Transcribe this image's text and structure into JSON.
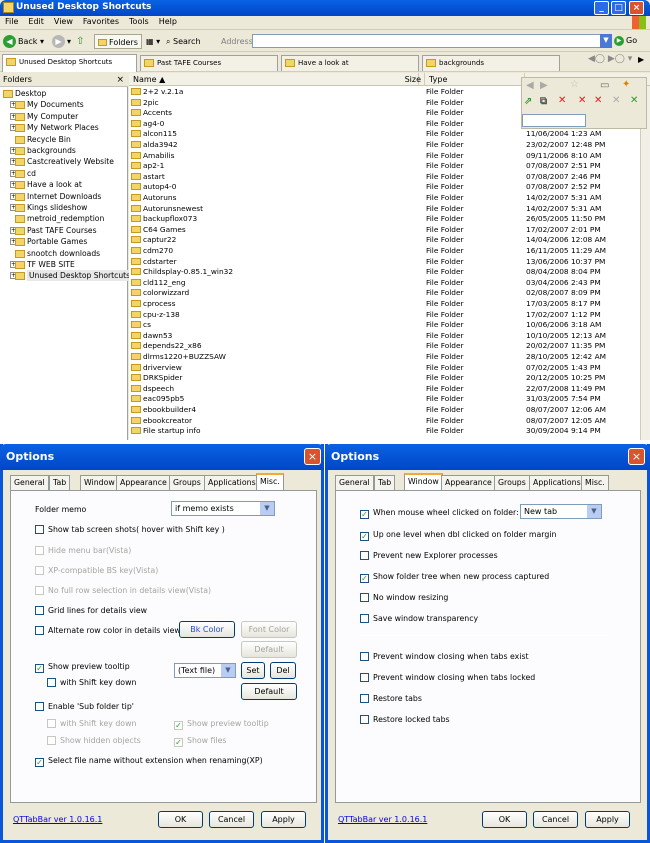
{
  "explorer": {
    "title": "Unused Desktop Shortcuts",
    "menu": [
      "File",
      "Edit",
      "View",
      "Favorites",
      "Tools",
      "Help"
    ],
    "toolbar": {
      "back": "Back",
      "folders": "Folders",
      "search": "Search",
      "address_label": "Address",
      "address_value": "",
      "go": "Go"
    },
    "tabs": [
      "Unused Desktop Shortcuts",
      "Past TAFE Courses",
      "Have a look at",
      "backgrounds"
    ],
    "folders_header": "Folders",
    "tree": [
      {
        "label": "Desktop",
        "level": 0,
        "expander": "-"
      },
      {
        "label": "My Documents",
        "level": 1,
        "expander": "+"
      },
      {
        "label": "My Computer",
        "level": 1,
        "expander": "+"
      },
      {
        "label": "My Network Places",
        "level": 1,
        "expander": "+"
      },
      {
        "label": "Recycle Bin",
        "level": 1,
        "expander": ""
      },
      {
        "label": "backgrounds",
        "level": 1,
        "expander": "+"
      },
      {
        "label": "Castcreatively Website",
        "level": 1,
        "expander": "+"
      },
      {
        "label": "cd",
        "level": 1,
        "expander": "+"
      },
      {
        "label": "Have a look at",
        "level": 1,
        "expander": "+"
      },
      {
        "label": "Internet Downloads",
        "level": 1,
        "expander": "+"
      },
      {
        "label": "Kings slideshow",
        "level": 1,
        "expander": "+"
      },
      {
        "label": "metroid_redemption",
        "level": 1,
        "expander": ""
      },
      {
        "label": "Past TAFE Courses",
        "level": 1,
        "expander": "+"
      },
      {
        "label": "Portable Games",
        "level": 1,
        "expander": "+"
      },
      {
        "label": "snootch downloads",
        "level": 1,
        "expander": ""
      },
      {
        "label": "TF WEB SITE",
        "level": 1,
        "expander": "+"
      },
      {
        "label": "Unused Desktop Shortcuts",
        "level": 1,
        "expander": "+"
      }
    ],
    "columns": {
      "name": "Name",
      "size": "Size",
      "type": "Type"
    },
    "files": [
      {
        "name": "2+2 v.2.1a",
        "type": "File Folder",
        "date": ""
      },
      {
        "name": "2pic",
        "type": "File Folder",
        "date": ""
      },
      {
        "name": "Accents",
        "type": "File Folder",
        "date": ""
      },
      {
        "name": "ag4-0",
        "type": "File Folder",
        "date": ""
      },
      {
        "name": "alcon115",
        "type": "File Folder",
        "date": "11/06/2004 1:23 AM"
      },
      {
        "name": "alda3942",
        "type": "File Folder",
        "date": "23/02/2007 12:48 PM"
      },
      {
        "name": "Amabilis",
        "type": "File Folder",
        "date": "09/11/2006 8:10 AM"
      },
      {
        "name": "ap2-1",
        "type": "File Folder",
        "date": "07/08/2007 2:51 PM"
      },
      {
        "name": "astart",
        "type": "File Folder",
        "date": "07/08/2007 2:46 PM"
      },
      {
        "name": "autop4-0",
        "type": "File Folder",
        "date": "07/08/2007 2:52 PM"
      },
      {
        "name": "Autoruns",
        "type": "File Folder",
        "date": "14/02/2007 5:31 AM"
      },
      {
        "name": "Autorunsnewest",
        "type": "File Folder",
        "date": "14/02/2007 5:31 AM"
      },
      {
        "name": "backupflox073",
        "type": "File Folder",
        "date": "26/05/2005 11:50 PM"
      },
      {
        "name": "C64 Games",
        "type": "File Folder",
        "date": "17/02/2007 2:01 PM"
      },
      {
        "name": "captur22",
        "type": "File Folder",
        "date": "14/04/2006 12:08 AM"
      },
      {
        "name": "cdm270",
        "type": "File Folder",
        "date": "16/11/2005 11:29 AM"
      },
      {
        "name": "cdstarter",
        "type": "File Folder",
        "date": "13/06/2006 10:37 PM"
      },
      {
        "name": "Childsplay-0.85.1_win32",
        "type": "File Folder",
        "date": "08/04/2008 8:04 PM"
      },
      {
        "name": "cld112_eng",
        "type": "File Folder",
        "date": "03/04/2006 2:43 PM"
      },
      {
        "name": "colorwizzard",
        "type": "File Folder",
        "date": "02/08/2007 8:09 PM"
      },
      {
        "name": "cprocess",
        "type": "File Folder",
        "date": "17/03/2005 8:17 PM"
      },
      {
        "name": "cpu-z-138",
        "type": "File Folder",
        "date": "17/02/2007 1:12 PM"
      },
      {
        "name": "cs",
        "type": "File Folder",
        "date": "10/06/2006 3:18 AM"
      },
      {
        "name": "dawn53",
        "type": "File Folder",
        "date": "10/10/2005 12:13 AM"
      },
      {
        "name": "depends22_x86",
        "type": "File Folder",
        "date": "20/02/2007 11:35 PM"
      },
      {
        "name": "dlrms1220+BUZZSAW",
        "type": "File Folder",
        "date": "28/10/2005 12:42 AM"
      },
      {
        "name": "driverview",
        "type": "File Folder",
        "date": "07/02/2005 1:43 PM"
      },
      {
        "name": "DRKSpider",
        "type": "File Folder",
        "date": "20/12/2005 10:25 PM"
      },
      {
        "name": "dspeech",
        "type": "File Folder",
        "date": "22/07/2008 11:49 PM"
      },
      {
        "name": "eac095pb5",
        "type": "File Folder",
        "date": "31/03/2005 7:54 PM"
      },
      {
        "name": "ebookbuilder4",
        "type": "File Folder",
        "date": "08/07/2007 12:06 AM"
      },
      {
        "name": "ebookcreator",
        "type": "File Folder",
        "date": "08/07/2007 12:05 AM"
      },
      {
        "name": "File startup info",
        "type": "File Folder",
        "date": "30/09/2004 9:14 PM"
      }
    ]
  },
  "dialog_misc": {
    "title": "Options",
    "tabs": [
      "General",
      "Tab",
      "Window",
      "Appearance",
      "Groups",
      "Applications",
      "Misc."
    ],
    "folder_memo_label": "Folder memo",
    "folder_memo_value": "if memo exists",
    "show_screenshots": "Show tab screen shots( hover with Shift key )",
    "hide_menubar": "Hide menu bar(Vista)",
    "xp_bs": "XP-compatible BS key(Vista)",
    "no_full_row": "No full row selection in details view(Vista)",
    "grid_lines": "Grid lines for details view",
    "alt_row": "Alternate row color in details view",
    "bk_color": "Bk Color",
    "font_color": "Font Color",
    "default1": "Default",
    "show_preview": "Show preview tooltip",
    "with_shift": "with Shift key down",
    "preview_select": "(Text file)",
    "set": "Set",
    "del": "Del",
    "default2": "Default",
    "enable_sub": "Enable 'Sub folder tip'",
    "sub_with_shift": "with Shift key down",
    "sub_preview": "Show preview tooltip",
    "sub_hidden": "Show hidden objects",
    "sub_files": "Show files",
    "select_name": "Select file name without extension when renaming(XP)",
    "version": "QTTabBar ver 1.0.16.1",
    "ok": "OK",
    "cancel": "Cancel",
    "apply": "Apply"
  },
  "dialog_window": {
    "title": "Options",
    "tabs": [
      "General",
      "Tab",
      "Window",
      "Appearance",
      "Groups",
      "Applications",
      "Misc."
    ],
    "wheel_label": "When mouse wheel clicked on folder:",
    "wheel_value": "New tab",
    "up_one": "Up one level when dbl clicked on folder margin",
    "prevent_new": "Prevent new Explorer processes",
    "show_tree": "Show folder tree when new process captured",
    "no_resize": "No window resizing",
    "save_trans": "Save window transparency",
    "prevent_tabs": "Prevent window closing when tabs exist",
    "prevent_locked": "Prevent window closing when tabs locked",
    "restore_tabs": "Restore tabs",
    "restore_locked": "Restore locked tabs",
    "version": "QTTabBar ver 1.0.16.1",
    "ok": "OK",
    "cancel": "Cancel",
    "apply": "Apply"
  },
  "colors": {
    "xp_blue": "#0a56d9",
    "close_red": "#d9542e",
    "folder_yellow": "#f3d469",
    "check_green": "#21a121"
  }
}
